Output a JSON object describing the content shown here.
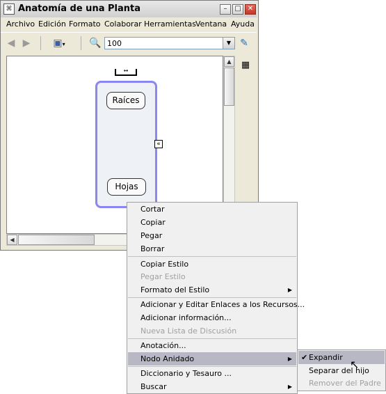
{
  "window": {
    "title": "Anatomía de una Planta",
    "buttons": {
      "minimize": "–",
      "maximize": "□",
      "close": "✕"
    }
  },
  "menubar": [
    "Archivo",
    "Edición",
    "Formato",
    "Colaborar",
    "Herramientas",
    "Ventana",
    "Ayuda"
  ],
  "toolbar": {
    "zoom_value": "100",
    "icons": [
      "back-arrow-icon",
      "forward-arrow-icon",
      "view-icon",
      "zoom-icon",
      "style-palette-icon"
    ]
  },
  "concept_map": {
    "nodes": [
      "Raíces",
      "Hojas"
    ]
  },
  "context_menu": {
    "items": [
      {
        "label": "Cortar",
        "enabled": true
      },
      {
        "label": "Copiar",
        "enabled": true
      },
      {
        "label": "Pegar",
        "enabled": true
      },
      {
        "label": "Borrar",
        "enabled": true
      },
      {
        "label": "Copiar Estilo",
        "enabled": true
      },
      {
        "label": "Pegar Estilo",
        "enabled": false
      },
      {
        "label": "Formato del Estilo",
        "enabled": true,
        "submenu": true
      },
      {
        "label": "Adicionar y Editar Enlaces a los Recursos...",
        "enabled": true
      },
      {
        "label": "Adicionar información...",
        "enabled": true
      },
      {
        "label": "Nueva Lista de Discusión",
        "enabled": false
      },
      {
        "label": "Anotación...",
        "enabled": true
      },
      {
        "label": "Nodo Anidado",
        "enabled": true,
        "submenu": true,
        "highlighted": true
      },
      {
        "label": "Diccionario y Tesauro ...",
        "enabled": true
      },
      {
        "label": "Buscar",
        "enabled": true,
        "submenu": true
      }
    ]
  },
  "submenu": {
    "items": [
      {
        "label": "Expandir",
        "enabled": true,
        "checked": true,
        "highlighted": true
      },
      {
        "label": "Separar del hijo",
        "enabled": true
      },
      {
        "label": "Remover del Padre",
        "enabled": false
      }
    ]
  },
  "colors": {
    "node_border": "#8888f0",
    "highlight": "#b8b8c4",
    "disabled_text": "#a0a0a0"
  }
}
